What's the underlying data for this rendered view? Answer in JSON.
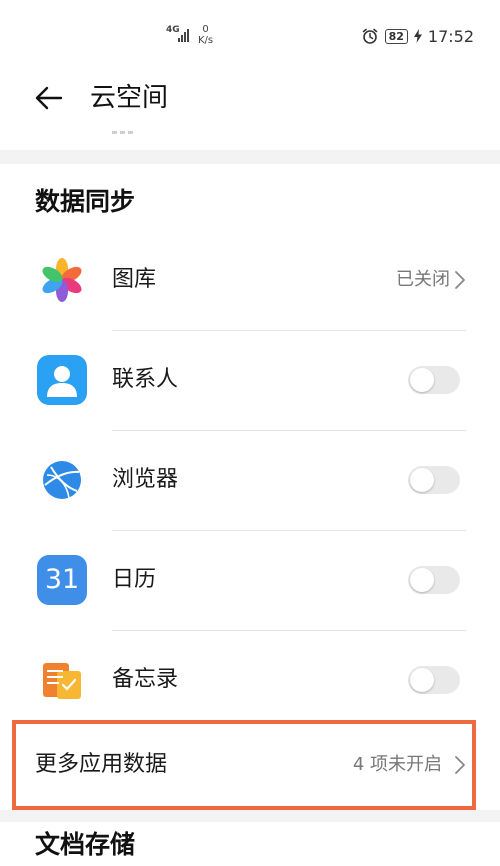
{
  "status_bar": {
    "network": "4G",
    "speed_value": "0",
    "speed_unit": "K/s",
    "battery": "82",
    "time": "17:52"
  },
  "header": {
    "title": "云空间"
  },
  "data_sync": {
    "section_title": "数据同步",
    "gallery": {
      "label": "图库",
      "status": "已关闭"
    },
    "toggle_rows": [
      {
        "label": "联系人",
        "on": false
      },
      {
        "label": "浏览器",
        "on": false
      },
      {
        "label": "日历",
        "on": false,
        "icon_text": "31"
      },
      {
        "label": "备忘录",
        "on": false
      }
    ],
    "more": {
      "label": "更多应用数据",
      "status": "4 项未开启"
    }
  },
  "doc_storage": {
    "section_title": "文档存储"
  },
  "colors": {
    "highlight": "#ee6840",
    "contacts_icon": "#2aa1f2",
    "calendar_icon": "#3f8ee8",
    "browser_icon": "#2d8ae6",
    "notes_icon": "#f0812f"
  }
}
